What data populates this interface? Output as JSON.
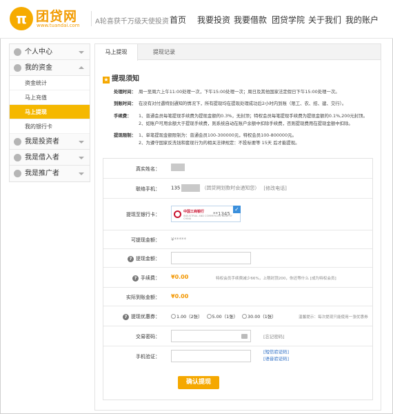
{
  "header": {
    "logo_char": "π",
    "logo_name": "团贷网",
    "logo_url": "www.tuandai.com",
    "slogan": "A轮喜获千万级天使投资",
    "nav": [
      "首页",
      "我要投资",
      "我要借款",
      "团贷学院",
      "关于我们",
      "我的账户"
    ]
  },
  "sidebar": {
    "groups": [
      {
        "label": "个人中心",
        "icon": "user-icon",
        "expanded": false
      },
      {
        "label": "我的资金",
        "icon": "money-icon",
        "expanded": true,
        "items": [
          "资金统计",
          "马上充值",
          "马上提现",
          "我的银行卡"
        ],
        "active_item": "马上提现"
      },
      {
        "label": "我是投资者",
        "icon": "investor-icon",
        "expanded": false
      },
      {
        "label": "我是借入者",
        "icon": "borrower-icon",
        "expanded": false
      },
      {
        "label": "我是推广者",
        "icon": "promoter-icon",
        "expanded": false
      }
    ]
  },
  "tabs": [
    "马上提现",
    "提现记录"
  ],
  "notice": {
    "title": "提现须知",
    "rows": [
      {
        "label": "处理时间：",
        "text": "周一至周六上午11:00处理一次，下午15:00处理一次；周日及其他国家法定假日下午15:00处理一次。"
      },
      {
        "label": "到账时间：",
        "text": "在没有对付遇特别通知的情况下，所有提现均在提现处理成功后2小时内到账（限工、农、招、建、交行）。"
      },
      {
        "label": "手续费：",
        "text": "1、普通会员每笔提现手续费为提现金额的0.3%，无封顶；特权会员每笔提现手续费为提现金额的0.1%,200元封顶。"
      },
      {
        "label": "",
        "text": "2、如账户可用余额大于提现手续费，则系统自动在账户余额中扣除手续费，否则提现费用在提现金额中扣除。"
      },
      {
        "label": "提现限制：",
        "text": "1、单笔提现金额限制为：普通会员100-300000元，特权会员100-800000元。"
      },
      {
        "label": "",
        "text": "2、为遵守国家反洗钱和套现行为的相关法律规定：不投标要等 15天 后才能提现。"
      }
    ]
  },
  "form": {
    "real_name_label": "真实姓名：",
    "phone_label": "联络手机：",
    "phone_prefix": "135",
    "phone_hint": "（团贷网划款时会通知您）",
    "phone_modify": "[修改电话]",
    "bank_label": "提现至银行卡：",
    "bank_name": "中国工商银行",
    "bank_sub": "INDUSTRIAL AND COMMERCIAL BANK OF CHINA",
    "bank_tail": "**1345",
    "available_label": "可提现金额：",
    "available_value": "¥*****",
    "amount_label": "提现金额：",
    "fee_label": "手续费：",
    "fee_value": "¥0.00",
    "fee_hint": "特权会员手续费减少66%，上限封顶200，你还等什么",
    "fee_link": "[成为特权会员]",
    "actual_label": "实际到账金额：",
    "actual_value": "¥0.00",
    "coupon_label": "提现优惠券：",
    "coupons": [
      "1.00（2张）",
      "5.00（1张）",
      "30.00（1张）"
    ],
    "coupon_hint": "温馨提示：每次提现只能使用一张优惠券",
    "password_label": "交易密码：",
    "password_forgot": "[忘记密码]",
    "sms_label": "手机验证：",
    "sms_link1": "[短信验证码]",
    "sms_link2": "[语音验证码]",
    "submit_label": "确认提现"
  },
  "colors": {
    "brand": "#f29b00",
    "active_nav": "#f5b800",
    "link": "#2a6cc4"
  }
}
